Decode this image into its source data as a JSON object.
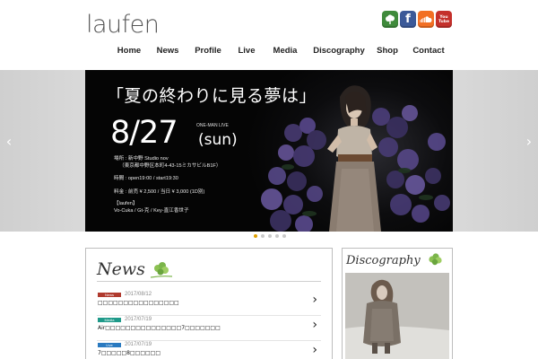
{
  "site": {
    "logo": "laufen"
  },
  "social": [
    {
      "name": "tree-icon",
      "color": "#3f8a3b"
    },
    {
      "name": "facebook-icon",
      "color": "#3b5998",
      "glyph": "f"
    },
    {
      "name": "soundcloud-icon",
      "color": "#f26f23"
    },
    {
      "name": "youtube-icon",
      "color": "#c4302b",
      "glyph": "You Tube"
    }
  ],
  "nav": [
    "Home",
    "News",
    "Profile",
    "Live",
    "Media",
    "Discography",
    "Shop",
    "Contact"
  ],
  "slider": {
    "title": "「夏の終わりに見る夢は」",
    "date": "8/27",
    "day": "(sun)",
    "tag": "ONE-MAN LIVE",
    "venue_1": "場所 : 新中野 Studio nov",
    "venue_2": "（東京都中野区本町4-43-15ミカサビルB1F）",
    "time": "時間 : open19:00 / start19:30",
    "price": "料金 : 前売 ¥ 2,500 / 当日 ¥ 3,000 (1D別)",
    "band": "【laufen】",
    "members": "Vo-Cuka / Gt-克 / Key-直江香世子",
    "prev_arrow": "‹",
    "next_arrow": "›",
    "slide_count": 5,
    "active_slide": 1
  },
  "news": {
    "heading": "News",
    "items": [
      {
        "badge": "News",
        "badge_color": "#b03a2e",
        "date": "2017/08/12",
        "title": "□□□□□□□□□□□□□□□□"
      },
      {
        "badge": "Media",
        "badge_color": "#1f9a8a",
        "date": "2017/07/19",
        "title": "Air□□□□□□□□□□□□□□□7□□□□□□□"
      },
      {
        "badge": "Live",
        "badge_color": "#2a7ac0",
        "date": "2017/07/19",
        "title": "7□□□□□8□□□□□□"
      }
    ],
    "chevron": "›"
  },
  "discography": {
    "heading": "Discography"
  }
}
